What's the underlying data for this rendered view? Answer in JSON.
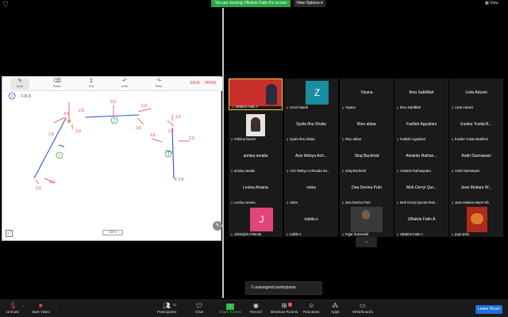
{
  "topbar": {
    "viewing_text": "You are viewing UBakrie Fatin A's screen",
    "view_options": "View Options ▾",
    "view_icon": "▦ View",
    "shield_color": "#3fbf5a"
  },
  "whiteboard": {
    "tools": [
      {
        "label": "Draw",
        "icon": "pen-icon"
      },
      {
        "label": "Eraser",
        "icon": "eraser-icon"
      },
      {
        "label": "Text",
        "icon": "text-icon"
      },
      {
        "label": "Undo",
        "icon": "undo-icon"
      },
      {
        "label": "Redo",
        "icon": "redo-icon"
      }
    ],
    "save_label": "SAVE",
    "more_label": "MORE",
    "zoom_label": "100 %",
    "ink_color": "#e0443f",
    "annotations": {
      "heading": "F.B.D",
      "ab": "2,8",
      "ab2": "2,8",
      "b2": "3,6",
      "bc": "2,6",
      "c2": "3,6",
      "n1": "2,8",
      "n2": "2,6",
      "n3": "2,6",
      "n4": "2,6",
      "n5": "2,6",
      "n6": "2,6",
      "f26": "F 2,6",
      "top": "3,6",
      "a2": "2,6",
      "bot": "2,6"
    }
  },
  "participants_tiles": [
    {
      "name": "",
      "label": "UBakrie Fatin A",
      "type": "screen",
      "speaking": true
    },
    {
      "name": "",
      "label": "zoom baa06",
      "type": "letter",
      "letter": "Z",
      "color": "#1a8da0"
    },
    {
      "name": "Viyana",
      "label": "Viyana"
    },
    {
      "name": "Ibnu Sabillilah",
      "label": "Ibnu Sabillilah"
    },
    {
      "name": "Lieta Adzani",
      "label": "Lieta Adzani"
    },
    {
      "name": "",
      "label": "Fahima Nazmi",
      "type": "photo"
    },
    {
      "name": "Syafa Ifna Shalia",
      "label": "Syafa Ifna Shalia"
    },
    {
      "name": "Rino akbar",
      "label": "Rino akbar"
    },
    {
      "name": "Fadilah Agustiani",
      "label": "Fadilah Agustiani"
    },
    {
      "name": "Eunike Yunita B...",
      "label": "Eunike Yunita Budiheri"
    },
    {
      "name": "annisa amalia",
      "label": "annisa amalia"
    },
    {
      "name": "Aziz Wahyu Ach...",
      "label": "Aziz Wahyu Achmada Sa..."
    },
    {
      "name": "Siraj Bachmid",
      "label": "Siraj Bachmid"
    },
    {
      "name": "Alvianto Raihan...",
      "label": "Alvianto Raihanputra"
    },
    {
      "name": "Andri Darmawan",
      "label": "Andri Darmawan"
    },
    {
      "name": "Levina Amaria",
      "label": "Levina Amaria"
    },
    {
      "name": "vinka",
      "label": "vinka"
    },
    {
      "name": "Dea Devina Putri",
      "label": "Dea Devina Putri"
    },
    {
      "name": "Muh Derryl Qur...",
      "label": "Muh Derryl Qurnia Ram..."
    },
    {
      "name": "Jean Mutiara W...",
      "label": "Jean Mutiara Wanir Hb"
    },
    {
      "name": "",
      "label": "Jofamijah Firlanda",
      "type": "letter",
      "letter": "J",
      "color": "#e0457b"
    },
    {
      "name": "nabila s",
      "label": "nabila s"
    },
    {
      "name": "",
      "label": "Fajar Kusnaufal",
      "type": "photo2"
    },
    {
      "name": "UBakrie Fatin A",
      "label": "UBakrie Fatin A"
    },
    {
      "name": "",
      "label": "puja aidia",
      "type": "photo3"
    }
  ],
  "unassigned": "2 unassigned participants",
  "toolbar": {
    "unmute": "Unmute",
    "start_video": "Start Video",
    "participants": "Participants",
    "participants_count": "32",
    "chat": "Chat",
    "share_screen": "Share Screen",
    "record": "Record",
    "breakout": "Breakout Rooms",
    "breakout_badge": "2",
    "reactions": "Reactions",
    "apps": "Apps",
    "whiteboards": "Whiteboards",
    "leave": "Leave Room"
  }
}
